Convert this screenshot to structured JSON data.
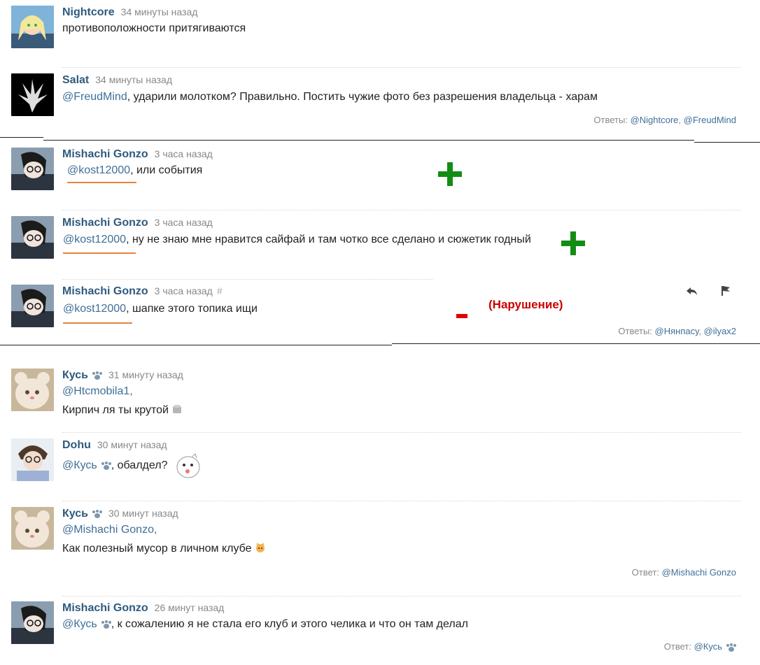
{
  "comments": [
    {
      "author": "Nightcore",
      "time": "34 минуты назад",
      "text": "противоположности притягиваются"
    },
    {
      "author": "Salat",
      "time": "34 минуты назад",
      "mention": "@FreudMind",
      "text": ", ударили молотком? Правильно. Постить чужие фото без разрешения владельца - харам",
      "replies_label": "Ответы:",
      "replies": [
        "@Nightcore",
        "@FreudMind"
      ]
    },
    {
      "author": "Mishachi Gonzo",
      "time": "3 часа назад",
      "mention": "@kost12000",
      "text": ",  или события"
    },
    {
      "author": "Mishachi Gonzo",
      "time": "3 часа назад",
      "mention": "@kost12000",
      "text": ", ну не знаю мне нравится сайфай и там чотко все сделано и сюжетик годный"
    },
    {
      "author": "Mishachi Gonzo",
      "time": "3 часа назад",
      "hash": "#",
      "mention": "@kost12000",
      "text": ", шапке этого топика ищи",
      "replies_label": "Ответы:",
      "replies": [
        "@Нянпасу",
        "@ilyax2"
      ]
    },
    {
      "author": "Кусь",
      "time": "31 минуту назад",
      "mention": "@Htcmobila1,",
      "text": "Кирпич ля ты крутой"
    },
    {
      "author": "Dohu",
      "time": "30 минут назад",
      "mention": "@Кусь",
      "text": ", обалдел?"
    },
    {
      "author": "Кусь",
      "time": "30 минут назад",
      "mention": "@Mishachi Gonzo,",
      "text": "Как полезный мусор в личном клубе",
      "replies_label": "Ответ:",
      "replies": [
        "@Mishachi Gonzo"
      ]
    },
    {
      "author": "Mishachi Gonzo",
      "time": "26 минут назад",
      "mention": "@Кусь",
      "text": ", к сожалению я не стала его клуб и этого челика и что он там делал",
      "replies_label": "Ответ:",
      "replies": [
        "@Кусь"
      ]
    }
  ],
  "annotations": {
    "violation": "(Нарушение)"
  },
  "colors": {
    "author": "#2f5a7d",
    "mention": "#3f6f98",
    "plus": "#148c14",
    "minus": "#e00000",
    "underline": "#e8843c"
  },
  "icons": [
    "reply-icon",
    "flag-icon",
    "paw-icon"
  ]
}
